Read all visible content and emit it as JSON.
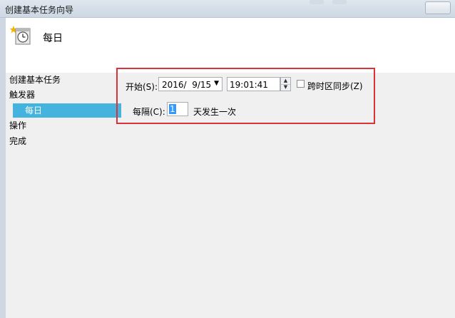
{
  "window": {
    "title": "创建基本任务向导"
  },
  "header": {
    "title": "每日",
    "icon": "clock-calendar-icon"
  },
  "nav": {
    "items": [
      "创建基本任务",
      "触发器",
      "每日",
      "操作",
      "完成"
    ],
    "selected_index": 2,
    "selected_color": "#44b4de"
  },
  "form": {
    "start_label": "开始(S):",
    "start_date": "2016/  9/15",
    "start_time": "19:01:41",
    "sync_label": "跨时区同步(Z)",
    "sync_checked": false,
    "every_label": "每隔(C):",
    "every_value": "1",
    "every_suffix": "天发生一次"
  },
  "highlight_color": "#d9323a"
}
